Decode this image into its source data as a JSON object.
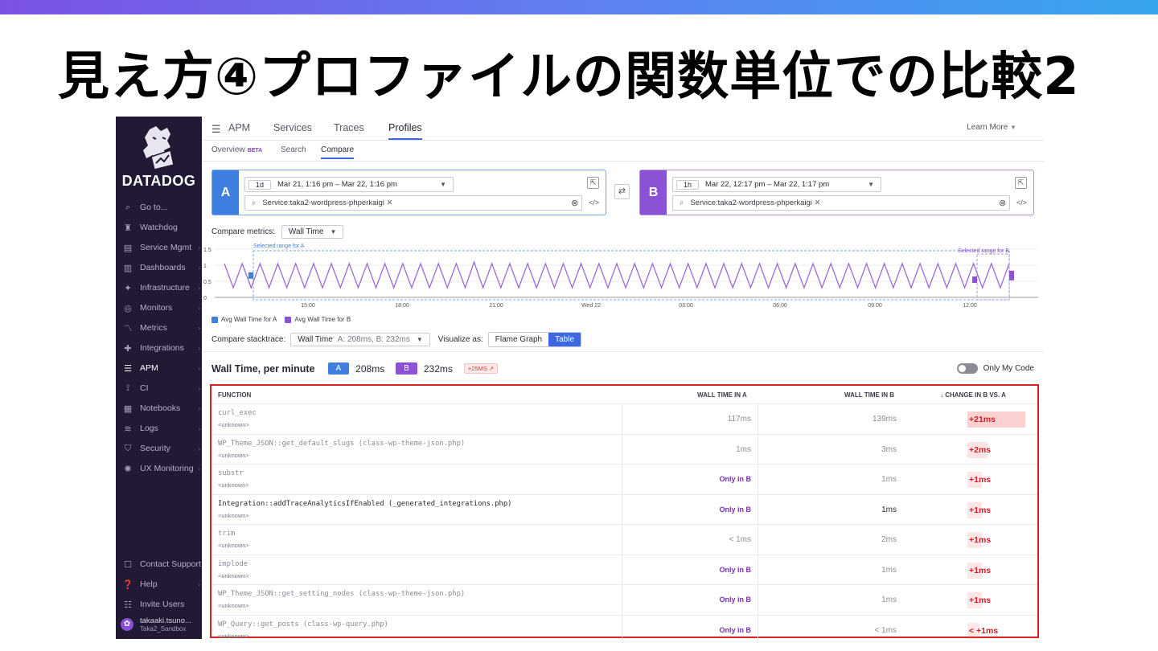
{
  "slide": {
    "title": "見え方④プロファイルの関数単位での比較2"
  },
  "colors": {
    "accent": "#3b68e0",
    "a_color": "#3f7fe0",
    "b_color": "#8c52d6",
    "sidebar_bg": "#221a35",
    "highlight_border": "#d9201e"
  },
  "sidebar": {
    "brand": "DATADOG",
    "items": [
      {
        "label": "Go to...",
        "icon": "search-icon",
        "glyph": "⌕"
      },
      {
        "label": "Watchdog",
        "icon": "binoculars-icon",
        "glyph": "♜"
      },
      {
        "label": "Service Mgmt",
        "icon": "monitor-icon",
        "glyph": "▤"
      },
      {
        "label": "Dashboards",
        "icon": "dashboard-icon",
        "glyph": "▥"
      },
      {
        "label": "Infrastructure",
        "icon": "infrastructure-icon",
        "glyph": "✦"
      },
      {
        "label": "Monitors",
        "icon": "monitor-alert-icon",
        "glyph": "◎"
      },
      {
        "label": "Metrics",
        "icon": "metrics-icon",
        "glyph": "〽"
      },
      {
        "label": "Integrations",
        "icon": "puzzle-icon",
        "glyph": "✚"
      },
      {
        "label": "APM",
        "icon": "apm-icon",
        "glyph": "☰"
      },
      {
        "label": "CI",
        "icon": "ci-icon",
        "glyph": "⟟"
      },
      {
        "label": "Notebooks",
        "icon": "notebook-icon",
        "glyph": "▦"
      },
      {
        "label": "Logs",
        "icon": "logs-icon",
        "glyph": "≋"
      },
      {
        "label": "Security",
        "icon": "shield-icon",
        "glyph": "⛉"
      },
      {
        "label": "UX Monitoring",
        "icon": "ux-icon",
        "glyph": "✺"
      }
    ],
    "bottom": [
      {
        "label": "Contact Support",
        "icon": "chat-icon",
        "glyph": "☐"
      },
      {
        "label": "Help",
        "icon": "help-icon",
        "glyph": "❓"
      },
      {
        "label": "Invite Users",
        "icon": "users-icon",
        "glyph": "☷"
      }
    ],
    "user": {
      "name": "takaaki.tsuno...",
      "org": "Taka2_Sandbox"
    }
  },
  "nav": {
    "tabs": [
      "APM",
      "Services",
      "Traces",
      "Profiles"
    ],
    "learn_more": "Learn More",
    "subtabs": [
      "Overview",
      "Search",
      "Compare"
    ],
    "beta": "BETA"
  },
  "queryA": {
    "label": "A",
    "range": "1d",
    "time": "Mar 21, 1:16 pm – Mar 22, 1:16 pm",
    "service": "Service:taka2-wordpress-phperkaigi"
  },
  "queryB": {
    "label": "B",
    "range": "1h",
    "time": "Mar 22, 12:17 pm – Mar 22, 1:17 pm",
    "service": "Service:taka2-wordpress-phperkaigi"
  },
  "compare": {
    "metrics_label": "Compare metrics:",
    "metric": "Wall Time"
  },
  "chart_data": {
    "type": "line",
    "y_ticks": [
      "0",
      "0.5",
      "1",
      "1.5"
    ],
    "ylim": [
      0,
      1.6
    ],
    "x_ticks": [
      "15:00",
      "18:00",
      "21:00",
      "Wed 22",
      "03:00",
      "06:00",
      "09:00",
      "12:00"
    ],
    "annotations": [
      "Selected range for A",
      "Selected range for B"
    ],
    "legend": [
      "Avg Wall Time for A",
      "Avg Wall Time for B"
    ],
    "series": [
      {
        "values": [
          1.05,
          0.3,
          1.05,
          0.3,
          1.05,
          0.3,
          1.05,
          0.3,
          1.05,
          0.3,
          1.05,
          0.3,
          1.05,
          0.3,
          1.05,
          0.3,
          1.05,
          0.3,
          1.05,
          0.3,
          1.05,
          0.3,
          1.05,
          0.3,
          1.05,
          0.3,
          1.05,
          0.3,
          1.1,
          0.3,
          1.05,
          0.3,
          1.05,
          0.3,
          1.05,
          0.3,
          1.05,
          0.3,
          1.05,
          0.3,
          1.05,
          0.3,
          1.05,
          0.3,
          1.05,
          0.3,
          1.05,
          0.3,
          1.05,
          0.3,
          1.05,
          0.3,
          1.05,
          0.3,
          1.05,
          0.3,
          1.05,
          0.3,
          1.05,
          0.3,
          1.05,
          0.3,
          1.05,
          0.3,
          1.05,
          0.3,
          1.05,
          0.3,
          1.05,
          0.3,
          1.05,
          0.3,
          1.05,
          0.3,
          1.05,
          0.3,
          1.05,
          0.3,
          1.05,
          0.3,
          1.05,
          0.3,
          1.05,
          0.3,
          1.05,
          0.3,
          1.05,
          0.3,
          1.05
        ]
      }
    ],
    "avg_a": 0.68,
    "avg_b": 0.55
  },
  "stack": {
    "label": "Compare stacktrace:",
    "metric": "Wall Time",
    "detail": "A: 208ms, B: 232ms",
    "visualize_label": "Visualize as:",
    "options": [
      "Flame Graph",
      "Table"
    ],
    "selected": "Table"
  },
  "summary": {
    "title": "Wall Time, per minute",
    "a_label": "A",
    "a_value": "208ms",
    "b_label": "B",
    "b_value": "232ms",
    "delta": "+25MS ↗",
    "toggle_label": "Only My Code"
  },
  "table": {
    "headers": [
      "FUNCTION",
      "WALL TIME IN A",
      "WALL TIME IN B",
      "↓  CHANGE IN B VS. A"
    ],
    "rows": [
      {
        "fn": "curl_exec",
        "sub": "<unknown>",
        "a": "117ms",
        "b": "139ms",
        "change": "+21ms",
        "strength": 1.0,
        "dark": false
      },
      {
        "fn": "WP_Theme_JSON::get_default_slugs (class-wp-theme-json.php)",
        "sub": "<unknown>",
        "a": "1ms",
        "b": "3ms",
        "change": "+2ms",
        "strength": 0.35,
        "dark": false
      },
      {
        "fn": "substr",
        "sub": "<unknown>",
        "a": "Only in B",
        "b": "1ms",
        "change": "+1ms",
        "strength": 0.25,
        "dark": false
      },
      {
        "fn": "Integration::addTraceAnalyticsIfEnabled (_generated_integrations.php)",
        "sub": "<unknown>",
        "a": "Only in B",
        "b": "1ms",
        "change": "+1ms",
        "strength": 0.25,
        "dark": true
      },
      {
        "fn": "trim",
        "sub": "<unknown>",
        "a": "< 1ms",
        "b": "2ms",
        "change": "+1ms",
        "strength": 0.25,
        "dark": false
      },
      {
        "fn": "implode",
        "sub": "<unknown>",
        "a": "Only in B",
        "b": "1ms",
        "change": "+1ms",
        "strength": 0.25,
        "dark": false
      },
      {
        "fn": "WP_Theme_JSON::get_setting_nodes (class-wp-theme-json.php)",
        "sub": "<unknown>",
        "a": "Only in B",
        "b": "1ms",
        "change": "+1ms",
        "strength": 0.25,
        "dark": false
      },
      {
        "fn": "WP_Query::get_posts (class-wp-query.php)",
        "sub": "<unknown>",
        "a": "Only in B",
        "b": "< 1ms",
        "change": "< +1ms",
        "strength": 0.2,
        "dark": false
      }
    ]
  }
}
